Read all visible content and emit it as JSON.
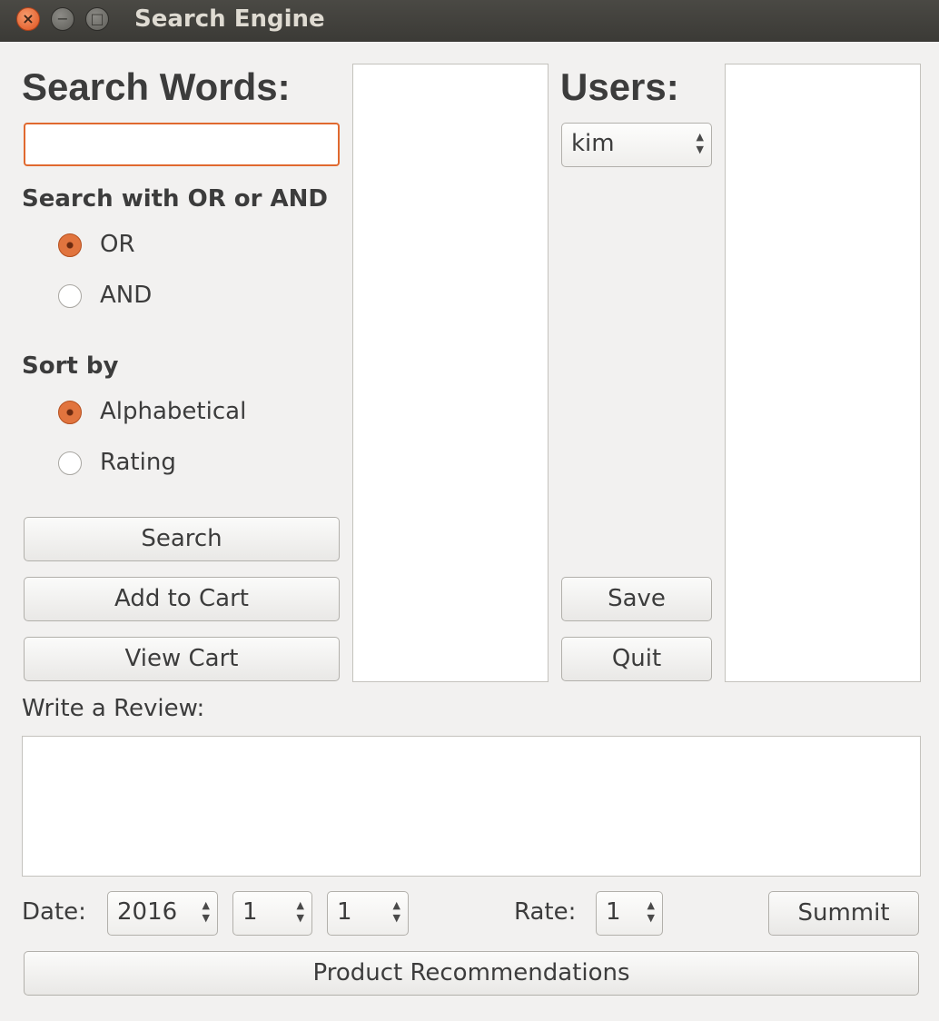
{
  "window": {
    "title": "Search Engine"
  },
  "left": {
    "heading": "Search Words:",
    "search_value": "",
    "mode_label": "Search with OR or AND",
    "mode_options": [
      {
        "label": "OR",
        "selected": true
      },
      {
        "label": "AND",
        "selected": false
      }
    ],
    "sort_label": "Sort by",
    "sort_options": [
      {
        "label": "Alphabetical",
        "selected": true
      },
      {
        "label": "Rating",
        "selected": false
      }
    ],
    "search_button": "Search",
    "add_to_cart_button": "Add to Cart",
    "view_cart_button": "View Cart"
  },
  "users": {
    "heading": "Users:",
    "selected_user": "kim",
    "save_button": "Save",
    "quit_button": "Quit"
  },
  "review": {
    "label": "Write a Review:",
    "text": "",
    "date_label": "Date:",
    "year": "2016",
    "month": "1",
    "day": "1",
    "rate_label": "Rate:",
    "rate": "1",
    "submit_button": "Summit"
  },
  "recommend_button": "Product Recommendations",
  "colors": {
    "accent": "#e0692f",
    "window_bg": "#f2f1f0",
    "titlebar": "#3c3b37"
  }
}
